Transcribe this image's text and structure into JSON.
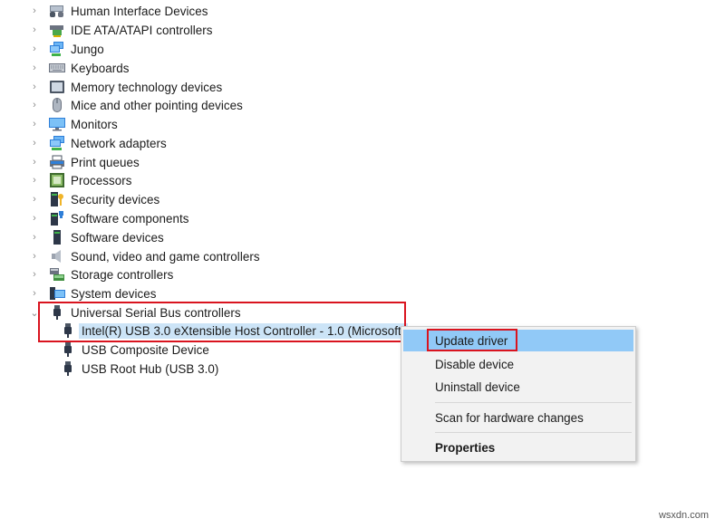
{
  "tree": {
    "categories": [
      {
        "label": "Human Interface Devices",
        "icon": "hid-icon",
        "expanded": false
      },
      {
        "label": "IDE ATA/ATAPI controllers",
        "icon": "ide-controller-icon",
        "expanded": false
      },
      {
        "label": "Jungo",
        "icon": "network-icon",
        "expanded": false
      },
      {
        "label": "Keyboards",
        "icon": "keyboard-icon",
        "expanded": false
      },
      {
        "label": "Memory technology devices",
        "icon": "memory-device-icon",
        "expanded": false
      },
      {
        "label": "Mice and other pointing devices",
        "icon": "mouse-icon",
        "expanded": false
      },
      {
        "label": "Monitors",
        "icon": "monitor-icon",
        "expanded": false
      },
      {
        "label": "Network adapters",
        "icon": "network-adapter-icon",
        "expanded": false
      },
      {
        "label": "Print queues",
        "icon": "printer-icon",
        "expanded": false
      },
      {
        "label": "Processors",
        "icon": "processor-icon",
        "expanded": false
      },
      {
        "label": "Security devices",
        "icon": "security-device-icon",
        "expanded": false
      },
      {
        "label": "Software components",
        "icon": "software-component-icon",
        "expanded": false
      },
      {
        "label": "Software devices",
        "icon": "software-device-icon",
        "expanded": false
      },
      {
        "label": "Sound, video and game controllers",
        "icon": "speaker-icon",
        "expanded": false
      },
      {
        "label": "Storage controllers",
        "icon": "storage-controller-icon",
        "expanded": false
      },
      {
        "label": "System devices",
        "icon": "system-device-icon",
        "expanded": false
      },
      {
        "label": "Universal Serial Bus controllers",
        "icon": "usb-icon",
        "expanded": true
      }
    ],
    "usb_children": [
      {
        "label": "Intel(R) USB 3.0 eXtensible Host Controller - 1.0 (Microsoft)",
        "icon": "usb-icon",
        "selected": true
      },
      {
        "label": "USB Composite Device",
        "icon": "usb-icon",
        "selected": false
      },
      {
        "label": "USB Root Hub (USB 3.0)",
        "icon": "usb-icon",
        "selected": false
      }
    ]
  },
  "context_menu": {
    "items": [
      {
        "label": "Update driver",
        "highlighted": true
      },
      {
        "label": "Disable device"
      },
      {
        "label": "Uninstall device"
      },
      {
        "label": "Scan for hardware changes"
      },
      {
        "label": "Properties",
        "bold": true
      }
    ]
  },
  "colors": {
    "highlight_annotation": "#d9141f",
    "selection": "#cce4f7",
    "menu_hover": "#91c9f7"
  },
  "watermark": "wsxdn.com"
}
